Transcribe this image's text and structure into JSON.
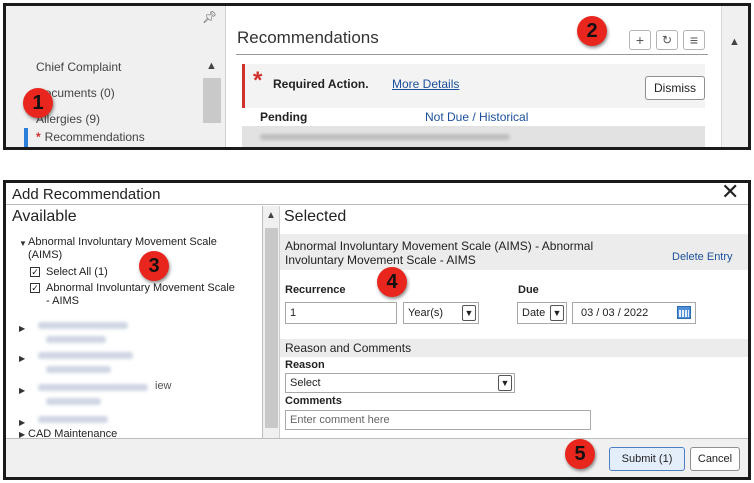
{
  "recommendations_panel": {
    "nav": {
      "items": [
        {
          "label": "Chief Complaint"
        },
        {
          "label": "Documents (0)"
        },
        {
          "label": "Allergies (9)"
        },
        {
          "label": "Recommendations",
          "required": true,
          "active": true
        }
      ]
    },
    "header": {
      "title": "Recommendations",
      "toolbar": {
        "add_icon": "plus-icon",
        "refresh_icon": "refresh-icon",
        "menu_icon": "menu-icon"
      }
    },
    "required_action": {
      "label": "Required Action.",
      "more_details": "More Details",
      "dismiss": "Dismiss"
    },
    "tabs": {
      "pending": "Pending",
      "not_due": "Not Due / Historical"
    }
  },
  "add_recommendation_dialog": {
    "title": "Add Recommendation",
    "available": {
      "title": "Available",
      "group": "Abnormal Involuntary Movement Scale (AIMS)",
      "group_line1": "Abnormal Involuntary Movement Scale",
      "group_line2": "(AIMS)",
      "select_all": "Select All (1)",
      "item_line1": "Abnormal Involuntary Movement Scale",
      "item_line2": "- AIMS",
      "partially_visible_text": "iew",
      "last_group": "CAD Maintenance"
    },
    "selected": {
      "title": "Selected",
      "entry_line1": "Abnormal Involuntary Movement Scale (AIMS) - Abnormal",
      "entry_line2": "Involuntary Movement Scale - AIMS",
      "delete_entry": "Delete Entry",
      "recurrence_label": "Recurrence",
      "recurrence_value": "1",
      "recurrence_unit": "Year(s)",
      "due_label": "Due",
      "due_type": "Date",
      "due_date": "03 / 03 / 2022",
      "reason_section": "Reason and Comments",
      "reason_label": "Reason",
      "reason_value": "Select",
      "comments_label": "Comments",
      "comments_placeholder": "Enter comment here"
    },
    "footer": {
      "submit": "Submit (1)",
      "cancel": "Cancel"
    }
  },
  "callouts": [
    "1",
    "2",
    "3",
    "4",
    "5"
  ],
  "colors": {
    "callout": "#e8261e",
    "link": "#1b4f9c",
    "required": "#d0312d",
    "active_bar": "#2b7fd8"
  }
}
